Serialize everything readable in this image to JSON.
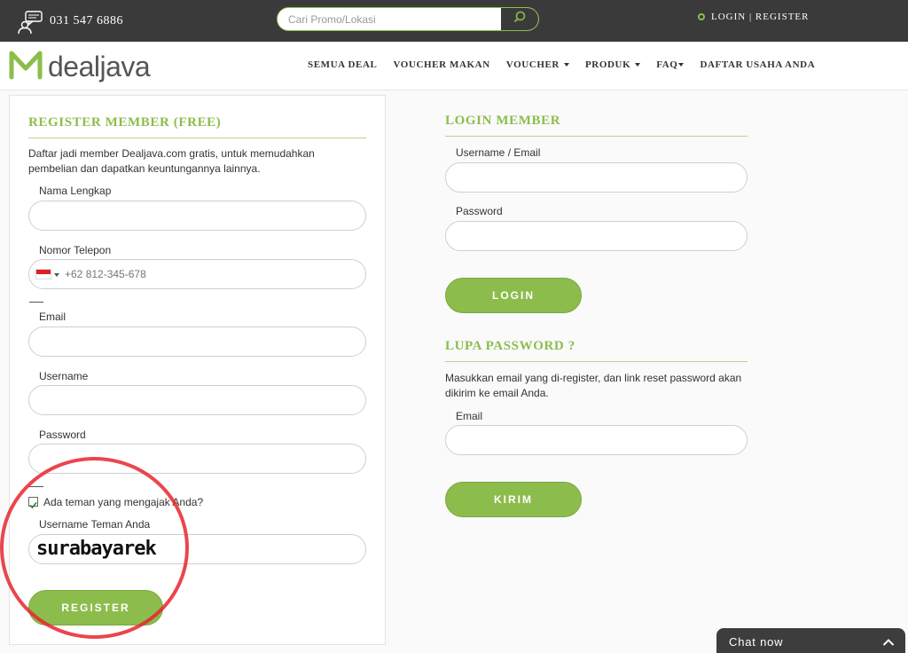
{
  "topbar": {
    "phone": "031 547 6886",
    "search_placeholder": "Cari Promo/Lokasi",
    "login_label": "LOGIN",
    "separator": " | ",
    "register_label": "REGISTER"
  },
  "brand": {
    "logo_text": "dealjava",
    "accent_color": "#8cbd4c"
  },
  "nav": {
    "items": [
      {
        "label": "SEMUA DEAL"
      },
      {
        "label": "VOUCHER MAKAN"
      },
      {
        "label": "VOUCHER"
      },
      {
        "label": "PRODUK"
      },
      {
        "label": "FAQ"
      },
      {
        "label": "DAFTAR USAHA ANDA"
      }
    ]
  },
  "register": {
    "title": "REGISTER MEMBER (FREE)",
    "description": "Daftar jadi member Dealjava.com gratis, untuk memudahkan pembelian dan dapatkan keuntungannya lainnya.",
    "name_label": "Nama Lengkap",
    "phone_label": "Nomor Telepon",
    "phone_placeholder": "+62 812-345-678",
    "email_label": "Email",
    "username_label": "Username",
    "password_label": "Password",
    "referral_checkbox_label": "Ada teman yang mengajak Anda?",
    "referral_checked": true,
    "referral_label": "Username Teman Anda",
    "referral_value": "surabayarek",
    "submit_label": "REGISTER"
  },
  "login": {
    "title": "LOGIN MEMBER",
    "username_label": "Username / Email",
    "password_label": "Password",
    "submit_label": "LOGIN"
  },
  "forgot": {
    "title": "LUPA PASSWORD ?",
    "description": "Masukkan email yang di-register, dan link reset password akan dikirim ke email Anda.",
    "email_label": "Email",
    "submit_label": "KIRIM"
  },
  "chat": {
    "label": "Chat now"
  }
}
